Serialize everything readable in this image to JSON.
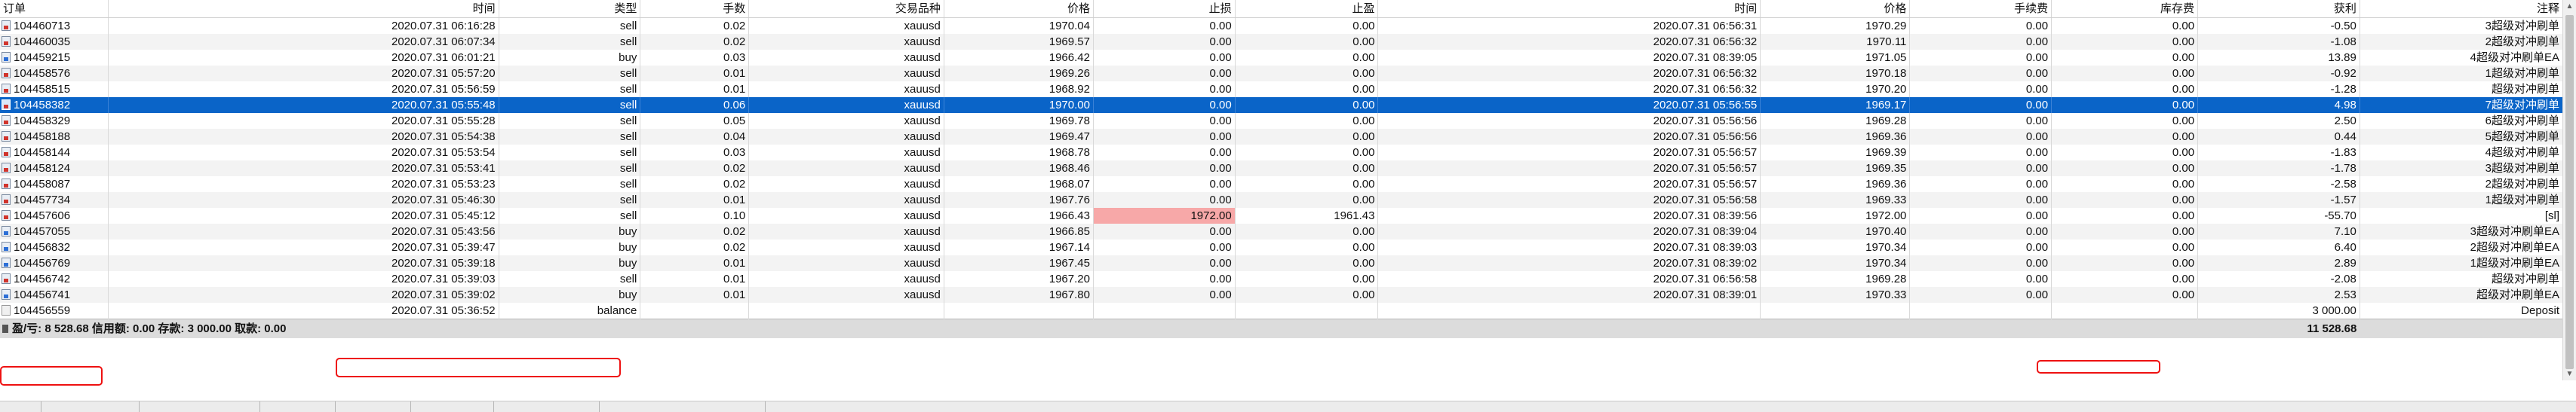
{
  "columns": {
    "order": "订单",
    "open_time": "时间",
    "type": "类型",
    "volume": "手数",
    "symbol": "交易品种",
    "open_price": "价格",
    "sl": "止损",
    "tp": "止盈",
    "close_time": "时间",
    "close_price": "价格",
    "commission": "手续费",
    "swap": "库存费",
    "profit": "获利",
    "comment": "注释"
  },
  "rows": [
    {
      "order": "104460713",
      "open_time": "2020.07.31 06:16:28",
      "type": "sell",
      "volume": "0.02",
      "symbol": "xauusd",
      "open_price": "1970.04",
      "sl": "0.00",
      "tp": "0.00",
      "close_time": "2020.07.31 06:56:31",
      "close_price": "1970.29",
      "commission": "0.00",
      "swap": "0.00",
      "profit": "-0.50",
      "comment": "3超级对冲刷单",
      "icon": "sell"
    },
    {
      "order": "104460035",
      "open_time": "2020.07.31 06:07:34",
      "type": "sell",
      "volume": "0.02",
      "symbol": "xauusd",
      "open_price": "1969.57",
      "sl": "0.00",
      "tp": "0.00",
      "close_time": "2020.07.31 06:56:32",
      "close_price": "1970.11",
      "commission": "0.00",
      "swap": "0.00",
      "profit": "-1.08",
      "comment": "2超级对冲刷单",
      "icon": "sell"
    },
    {
      "order": "104459215",
      "open_time": "2020.07.31 06:01:21",
      "type": "buy",
      "volume": "0.03",
      "symbol": "xauusd",
      "open_price": "1966.42",
      "sl": "0.00",
      "tp": "0.00",
      "close_time": "2020.07.31 08:39:05",
      "close_price": "1971.05",
      "commission": "0.00",
      "swap": "0.00",
      "profit": "13.89",
      "comment": "4超级对冲刷单EA",
      "icon": "buy"
    },
    {
      "order": "104458576",
      "open_time": "2020.07.31 05:57:20",
      "type": "sell",
      "volume": "0.01",
      "symbol": "xauusd",
      "open_price": "1969.26",
      "sl": "0.00",
      "tp": "0.00",
      "close_time": "2020.07.31 06:56:32",
      "close_price": "1970.18",
      "commission": "0.00",
      "swap": "0.00",
      "profit": "-0.92",
      "comment": "1超级对冲刷单",
      "icon": "sell"
    },
    {
      "order": "104458515",
      "open_time": "2020.07.31 05:56:59",
      "type": "sell",
      "volume": "0.01",
      "symbol": "xauusd",
      "open_price": "1968.92",
      "sl": "0.00",
      "tp": "0.00",
      "close_time": "2020.07.31 06:56:32",
      "close_price": "1970.20",
      "commission": "0.00",
      "swap": "0.00",
      "profit": "-1.28",
      "comment": "超级对冲刷单",
      "icon": "sell"
    },
    {
      "order": "104458382",
      "open_time": "2020.07.31 05:55:48",
      "type": "sell",
      "volume": "0.06",
      "symbol": "xauusd",
      "open_price": "1970.00",
      "sl": "0.00",
      "tp": "0.00",
      "close_time": "2020.07.31 05:56:55",
      "close_price": "1969.17",
      "commission": "0.00",
      "swap": "0.00",
      "profit": "4.98",
      "comment": "7超级对冲刷单",
      "icon": "sell",
      "selected": true
    },
    {
      "order": "104458329",
      "open_time": "2020.07.31 05:55:28",
      "type": "sell",
      "volume": "0.05",
      "symbol": "xauusd",
      "open_price": "1969.78",
      "sl": "0.00",
      "tp": "0.00",
      "close_time": "2020.07.31 05:56:56",
      "close_price": "1969.28",
      "commission": "0.00",
      "swap": "0.00",
      "profit": "2.50",
      "comment": "6超级对冲刷单",
      "icon": "sell"
    },
    {
      "order": "104458188",
      "open_time": "2020.07.31 05:54:38",
      "type": "sell",
      "volume": "0.04",
      "symbol": "xauusd",
      "open_price": "1969.47",
      "sl": "0.00",
      "tp": "0.00",
      "close_time": "2020.07.31 05:56:56",
      "close_price": "1969.36",
      "commission": "0.00",
      "swap": "0.00",
      "profit": "0.44",
      "comment": "5超级对冲刷单",
      "icon": "sell"
    },
    {
      "order": "104458144",
      "open_time": "2020.07.31 05:53:54",
      "type": "sell",
      "volume": "0.03",
      "symbol": "xauusd",
      "open_price": "1968.78",
      "sl": "0.00",
      "tp": "0.00",
      "close_time": "2020.07.31 05:56:57",
      "close_price": "1969.39",
      "commission": "0.00",
      "swap": "0.00",
      "profit": "-1.83",
      "comment": "4超级对冲刷单",
      "icon": "sell"
    },
    {
      "order": "104458124",
      "open_time": "2020.07.31 05:53:41",
      "type": "sell",
      "volume": "0.02",
      "symbol": "xauusd",
      "open_price": "1968.46",
      "sl": "0.00",
      "tp": "0.00",
      "close_time": "2020.07.31 05:56:57",
      "close_price": "1969.35",
      "commission": "0.00",
      "swap": "0.00",
      "profit": "-1.78",
      "comment": "3超级对冲刷单",
      "icon": "sell"
    },
    {
      "order": "104458087",
      "open_time": "2020.07.31 05:53:23",
      "type": "sell",
      "volume": "0.02",
      "symbol": "xauusd",
      "open_price": "1968.07",
      "sl": "0.00",
      "tp": "0.00",
      "close_time": "2020.07.31 05:56:57",
      "close_price": "1969.36",
      "commission": "0.00",
      "swap": "0.00",
      "profit": "-2.58",
      "comment": "2超级对冲刷单",
      "icon": "sell"
    },
    {
      "order": "104457734",
      "open_time": "2020.07.31 05:46:30",
      "type": "sell",
      "volume": "0.01",
      "symbol": "xauusd",
      "open_price": "1967.76",
      "sl": "0.00",
      "tp": "0.00",
      "close_time": "2020.07.31 05:56:58",
      "close_price": "1969.33",
      "commission": "0.00",
      "swap": "0.00",
      "profit": "-1.57",
      "comment": "1超级对冲刷单",
      "icon": "sell"
    },
    {
      "order": "104457606",
      "open_time": "2020.07.31 05:45:12",
      "type": "sell",
      "volume": "0.10",
      "symbol": "xauusd",
      "open_price": "1966.43",
      "sl": "1972.00",
      "tp": "1961.43",
      "close_time": "2020.07.31 08:39:56",
      "close_price": "1972.00",
      "commission": "0.00",
      "swap": "0.00",
      "profit": "-55.70",
      "comment": "[sl]",
      "icon": "sell",
      "sl_hit": true
    },
    {
      "order": "104457055",
      "open_time": "2020.07.31 05:43:56",
      "type": "buy",
      "volume": "0.02",
      "symbol": "xauusd",
      "open_price": "1966.85",
      "sl": "0.00",
      "tp": "0.00",
      "close_time": "2020.07.31 08:39:04",
      "close_price": "1970.40",
      "commission": "0.00",
      "swap": "0.00",
      "profit": "7.10",
      "comment": "3超级对冲刷单EA",
      "icon": "buy"
    },
    {
      "order": "104456832",
      "open_time": "2020.07.31 05:39:47",
      "type": "buy",
      "volume": "0.02",
      "symbol": "xauusd",
      "open_price": "1967.14",
      "sl": "0.00",
      "tp": "0.00",
      "close_time": "2020.07.31 08:39:03",
      "close_price": "1970.34",
      "commission": "0.00",
      "swap": "0.00",
      "profit": "6.40",
      "comment": "2超级对冲刷单EA",
      "icon": "buy"
    },
    {
      "order": "104456769",
      "open_time": "2020.07.31 05:39:18",
      "type": "buy",
      "volume": "0.01",
      "symbol": "xauusd",
      "open_price": "1967.45",
      "sl": "0.00",
      "tp": "0.00",
      "close_time": "2020.07.31 08:39:02",
      "close_price": "1970.34",
      "commission": "0.00",
      "swap": "0.00",
      "profit": "2.89",
      "comment": "1超级对冲刷单EA",
      "icon": "buy"
    },
    {
      "order": "104456742",
      "open_time": "2020.07.31 05:39:03",
      "type": "sell",
      "volume": "0.01",
      "symbol": "xauusd",
      "open_price": "1967.20",
      "sl": "0.00",
      "tp": "0.00",
      "close_time": "2020.07.31 06:56:58",
      "close_price": "1969.28",
      "commission": "0.00",
      "swap": "0.00",
      "profit": "-2.08",
      "comment": "超级对冲刷单",
      "icon": "sell"
    },
    {
      "order": "104456741",
      "open_time": "2020.07.31 05:39:02",
      "type": "buy",
      "volume": "0.01",
      "symbol": "xauusd",
      "open_price": "1967.80",
      "sl": "0.00",
      "tp": "0.00",
      "close_time": "2020.07.31 08:39:01",
      "close_price": "1970.33",
      "commission": "0.00",
      "swap": "0.00",
      "profit": "2.53",
      "comment": "超级对冲刷单EA",
      "icon": "buy"
    },
    {
      "order": "104456559",
      "open_time": "2020.07.31 05:36:52",
      "type": "balance",
      "volume": "",
      "symbol": "",
      "open_price": "",
      "sl": "",
      "tp": "",
      "close_time": "",
      "close_price": "",
      "commission": "",
      "swap": "",
      "profit": "3 000.00",
      "comment": "Deposit",
      "icon": "balance"
    }
  ],
  "summary": {
    "text": "盈/亏: 8 528.68 信用额: 0.00 存款: 3 000.00 取款: 0.00",
    "total": "11 528.68"
  },
  "colors": {
    "selected_row": "#0a64c8",
    "stop_loss_hit": "#f7a8a8",
    "highlight_box": "#e11111"
  }
}
